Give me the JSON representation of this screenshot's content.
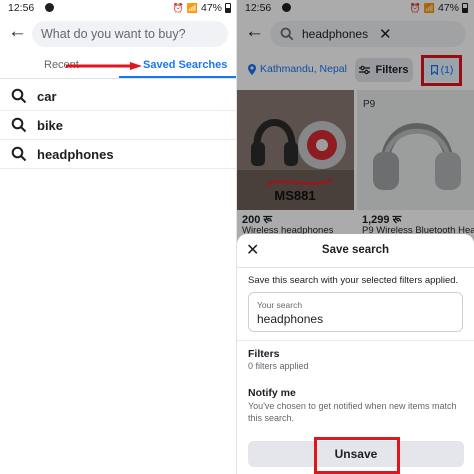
{
  "status": {
    "time": "12:56",
    "battery": "47%"
  },
  "left": {
    "search_placeholder": "What do you want to buy?",
    "tabs": [
      {
        "label": "Recent"
      },
      {
        "label": "Saved Searches",
        "active": true
      }
    ],
    "saved_searches": [
      {
        "label": "car"
      },
      {
        "label": "bike"
      },
      {
        "label": "headphones"
      }
    ]
  },
  "right": {
    "search_query": "headphones",
    "location": "Kathmandu, Nepal",
    "filters_label": "Filters",
    "saved_count": "(1)",
    "products": [
      {
        "price": "200 रू",
        "name": "Wireless headphones",
        "image_text": "MS881"
      },
      {
        "price": "1,299 रू",
        "name": "P9 Wireless Bluetooth Hea…",
        "image_text": "P9"
      }
    ],
    "sheet": {
      "title": "Save search",
      "description": "Save this search with your selected filters applied.",
      "your_search_label": "Your search",
      "your_search_value": "headphones",
      "filters_heading": "Filters",
      "filters_sub": "0 filters applied",
      "notify_heading": "Notify me",
      "notify_sub": "You've chosen to get notified when new items match this search.",
      "unsave_label": "Unsave"
    }
  },
  "colors": {
    "accent": "#1877f2",
    "highlight": "#e0161e"
  }
}
